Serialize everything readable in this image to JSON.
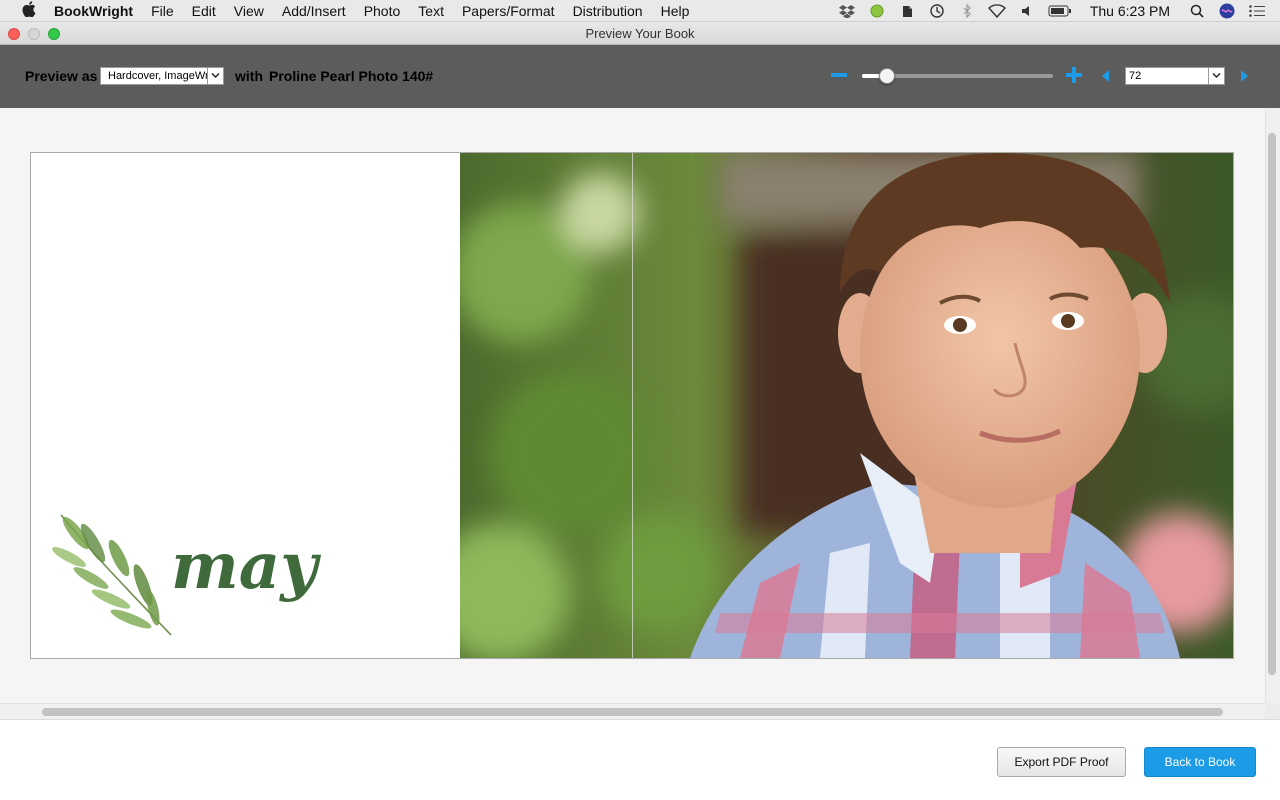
{
  "menubar": {
    "items": [
      "BookWright",
      "File",
      "Edit",
      "View",
      "Add/Insert",
      "Photo",
      "Text",
      "Papers/Format",
      "Distribution",
      "Help"
    ],
    "clock": "Thu 6:23 PM",
    "tray_icons": [
      "dropbox-icon",
      "status-dot-icon",
      "evernote-icon",
      "time-machine-icon",
      "bluetooth-icon",
      "wifi-icon",
      "volume-icon",
      "battery-icon"
    ]
  },
  "window": {
    "title": "Preview Your Book"
  },
  "toolbar": {
    "preview_as_label": "Preview as",
    "preview_as_value": "Hardcover, ImageWrap",
    "with_label": "with",
    "paper": "Proline Pearl Photo 140#",
    "zoom_level": 0.13,
    "page_value": "72"
  },
  "spread": {
    "title_word": "may"
  },
  "footer": {
    "export_label": "Export PDF Proof",
    "back_label": "Back to Book"
  },
  "colors": {
    "accent": "#1c9be6",
    "toolbar": "#5c5c5c",
    "title_green": "#3f6b3c"
  }
}
